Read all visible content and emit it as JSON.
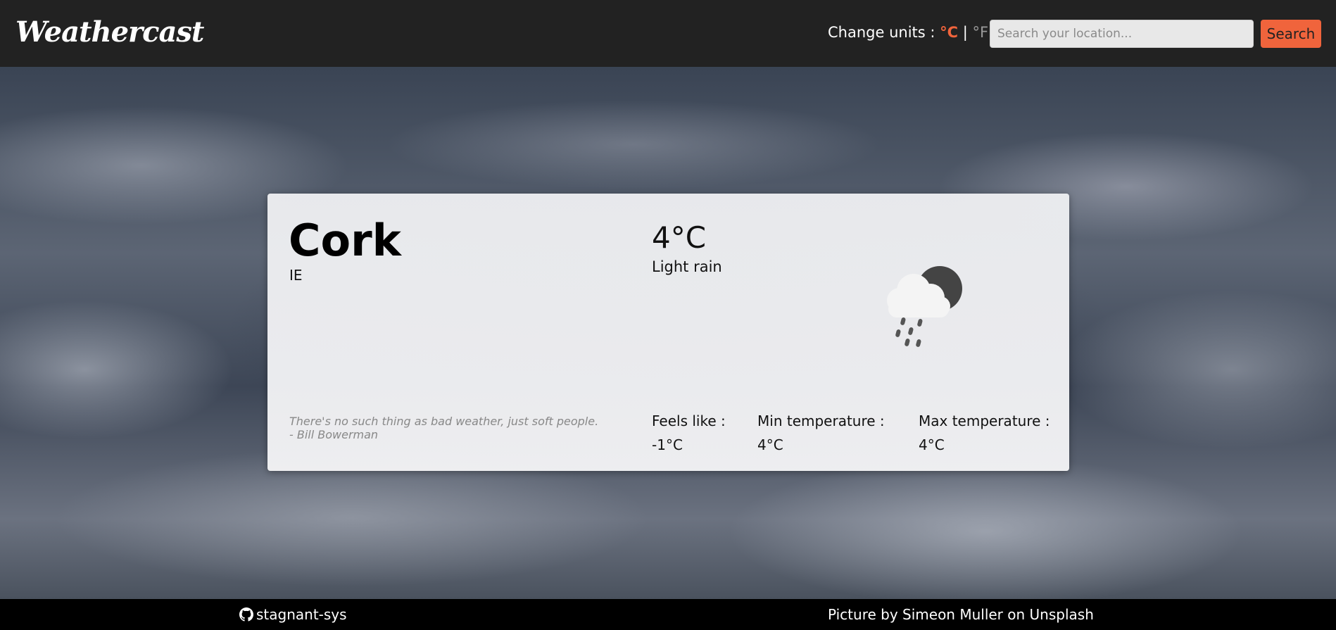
{
  "header": {
    "logo": "Weathercast",
    "units_label": "Change units :",
    "unit_c": "°C",
    "unit_sep": "|",
    "unit_f": "°F",
    "search_placeholder": "Search your location...",
    "search_button": "Search"
  },
  "weather": {
    "city": "Cork",
    "country": "IE",
    "temperature": "4°C",
    "condition": "Light rain",
    "icon": "cloud-rain-moon-icon",
    "quote_line1": "There's no such thing as bad weather, just soft people.",
    "quote_line2": "- Bill Bowerman",
    "feels_like_label": "Feels like :",
    "feels_like_value": "-1°C",
    "min_label": "Min temperature :",
    "min_value": "4°C",
    "max_label": "Max temperature :",
    "max_value": "4°C"
  },
  "footer": {
    "github_icon": "github-icon",
    "github_user": "stagnant-sys",
    "credit": "Picture by Simeon Muller on Unsplash"
  },
  "colors": {
    "accent": "#f0643c",
    "header_bg": "#222222",
    "footer_bg": "#000000"
  }
}
